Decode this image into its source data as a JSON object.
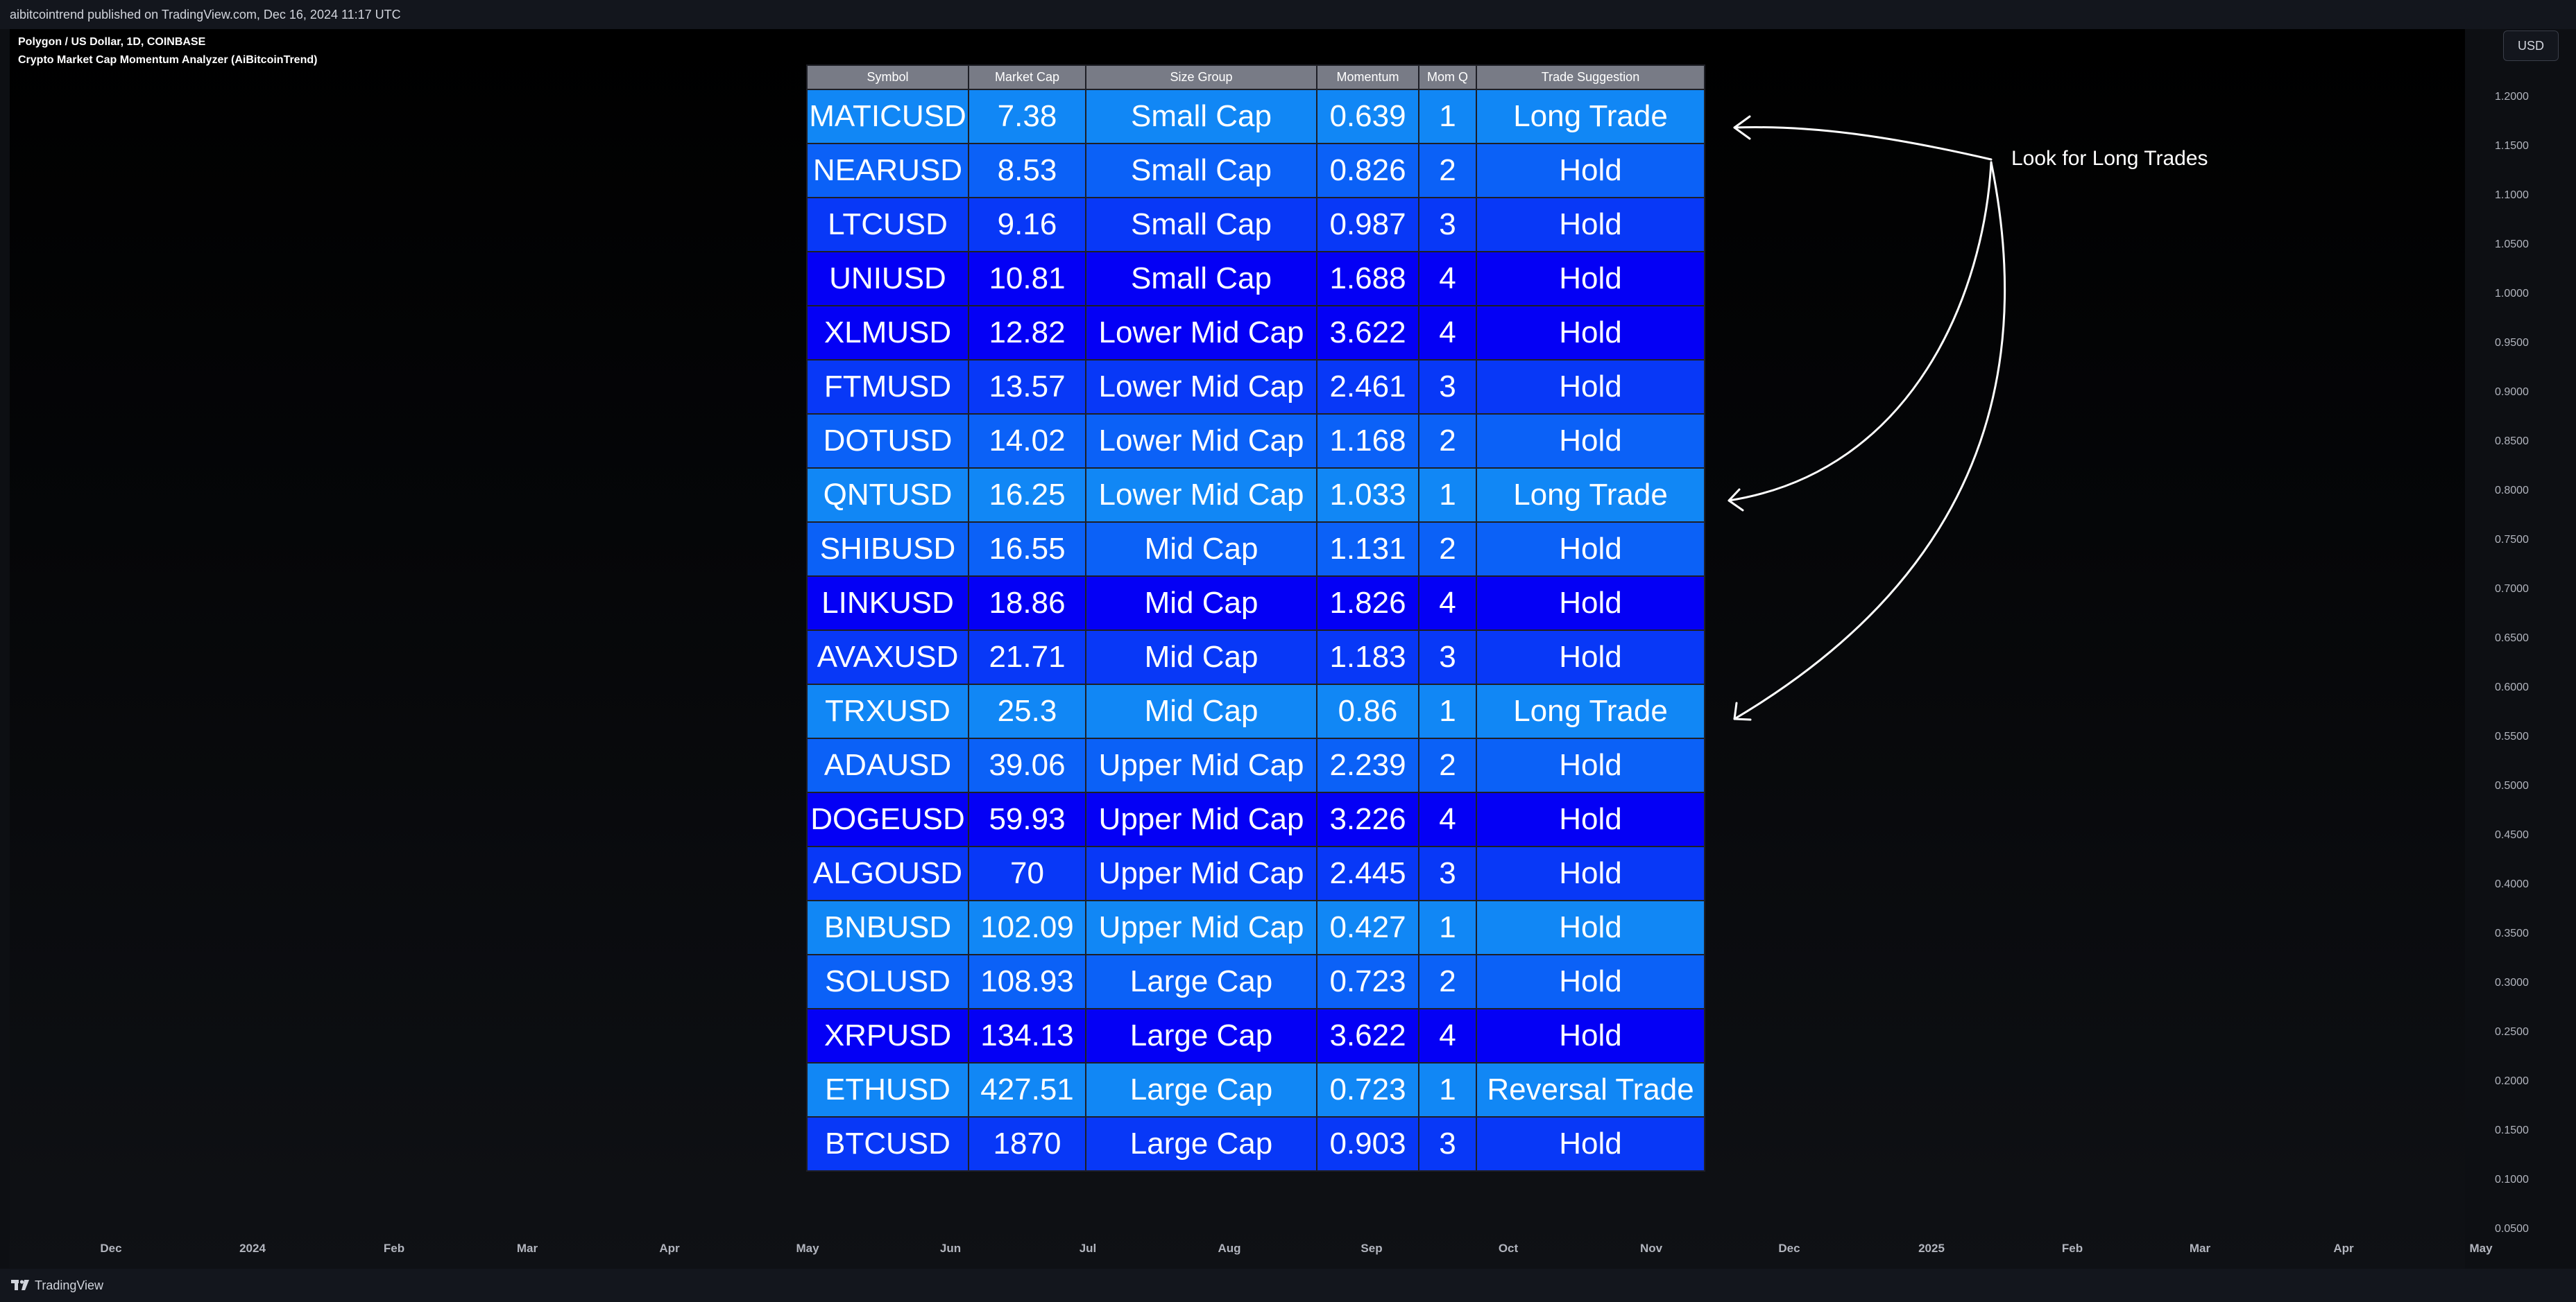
{
  "header": {
    "published": "aibitcointrend published on TradingView.com, Dec 16, 2024 11:17 UTC",
    "symbol_line": "Polygon / US Dollar, 1D, COINBASE",
    "indicator_line": "Crypto Market Cap Momentum Analyzer (AiBitcoinTrend)"
  },
  "currency_badge": "USD",
  "price_axis": [
    "1.2000",
    "1.1500",
    "1.1000",
    "1.0500",
    "1.0000",
    "0.9500",
    "0.9000",
    "0.8500",
    "0.8000",
    "0.7500",
    "0.7000",
    "0.6500",
    "0.6000",
    "0.5500",
    "0.5000",
    "0.4500",
    "0.4000",
    "0.3500",
    "0.3000",
    "0.2500",
    "0.2000",
    "0.1500",
    "0.1000",
    "0.0500"
  ],
  "time_axis": [
    "Dec",
    "2024",
    "Feb",
    "Mar",
    "Apr",
    "May",
    "Jun",
    "Jul",
    "Aug",
    "Sep",
    "Oct",
    "Nov",
    "Dec",
    "2025",
    "Feb",
    "Mar",
    "Apr",
    "May"
  ],
  "table": {
    "columns": [
      "Symbol",
      "Market Cap",
      "Size Group",
      "Momentum",
      "Mom Q",
      "Trade Suggestion"
    ],
    "quartile_colors": {
      "1": "#1187f5",
      "2": "#0b61f7",
      "3": "#0838f7",
      "4": "#0400f5"
    },
    "rows": [
      {
        "symbol": "MATICUSD",
        "market_cap": "7.38",
        "size_group": "Small Cap",
        "momentum": "0.639",
        "mom_q": "1",
        "suggestion": "Long Trade"
      },
      {
        "symbol": "NEARUSD",
        "market_cap": "8.53",
        "size_group": "Small Cap",
        "momentum": "0.826",
        "mom_q": "2",
        "suggestion": "Hold"
      },
      {
        "symbol": "LTCUSD",
        "market_cap": "9.16",
        "size_group": "Small Cap",
        "momentum": "0.987",
        "mom_q": "3",
        "suggestion": "Hold"
      },
      {
        "symbol": "UNIUSD",
        "market_cap": "10.81",
        "size_group": "Small Cap",
        "momentum": "1.688",
        "mom_q": "4",
        "suggestion": "Hold"
      },
      {
        "symbol": "XLMUSD",
        "market_cap": "12.82",
        "size_group": "Lower Mid Cap",
        "momentum": "3.622",
        "mom_q": "4",
        "suggestion": "Hold"
      },
      {
        "symbol": "FTMUSD",
        "market_cap": "13.57",
        "size_group": "Lower Mid Cap",
        "momentum": "2.461",
        "mom_q": "3",
        "suggestion": "Hold"
      },
      {
        "symbol": "DOTUSD",
        "market_cap": "14.02",
        "size_group": "Lower Mid Cap",
        "momentum": "1.168",
        "mom_q": "2",
        "suggestion": "Hold"
      },
      {
        "symbol": "QNTUSD",
        "market_cap": "16.25",
        "size_group": "Lower Mid Cap",
        "momentum": "1.033",
        "mom_q": "1",
        "suggestion": "Long Trade"
      },
      {
        "symbol": "SHIBUSD",
        "market_cap": "16.55",
        "size_group": "Mid Cap",
        "momentum": "1.131",
        "mom_q": "2",
        "suggestion": "Hold"
      },
      {
        "symbol": "LINKUSD",
        "market_cap": "18.86",
        "size_group": "Mid Cap",
        "momentum": "1.826",
        "mom_q": "4",
        "suggestion": "Hold"
      },
      {
        "symbol": "AVAXUSD",
        "market_cap": "21.71",
        "size_group": "Mid Cap",
        "momentum": "1.183",
        "mom_q": "3",
        "suggestion": "Hold"
      },
      {
        "symbol": "TRXUSD",
        "market_cap": "25.3",
        "size_group": "Mid Cap",
        "momentum": "0.86",
        "mom_q": "1",
        "suggestion": "Long Trade"
      },
      {
        "symbol": "ADAUSD",
        "market_cap": "39.06",
        "size_group": "Upper Mid Cap",
        "momentum": "2.239",
        "mom_q": "2",
        "suggestion": "Hold"
      },
      {
        "symbol": "DOGEUSD",
        "market_cap": "59.93",
        "size_group": "Upper Mid Cap",
        "momentum": "3.226",
        "mom_q": "4",
        "suggestion": "Hold"
      },
      {
        "symbol": "ALGOUSD",
        "market_cap": "70",
        "size_group": "Upper Mid Cap",
        "momentum": "2.445",
        "mom_q": "3",
        "suggestion": "Hold"
      },
      {
        "symbol": "BNBUSD",
        "market_cap": "102.09",
        "size_group": "Upper Mid Cap",
        "momentum": "0.427",
        "mom_q": "1",
        "suggestion": "Hold"
      },
      {
        "symbol": "SOLUSD",
        "market_cap": "108.93",
        "size_group": "Large Cap",
        "momentum": "0.723",
        "mom_q": "2",
        "suggestion": "Hold"
      },
      {
        "symbol": "XRPUSD",
        "market_cap": "134.13",
        "size_group": "Large Cap",
        "momentum": "3.622",
        "mom_q": "4",
        "suggestion": "Hold"
      },
      {
        "symbol": "ETHUSD",
        "market_cap": "427.51",
        "size_group": "Large Cap",
        "momentum": "0.723",
        "mom_q": "1",
        "suggestion": "Reversal Trade"
      },
      {
        "symbol": "BTCUSD",
        "market_cap": "1870",
        "size_group": "Large Cap",
        "momentum": "0.903",
        "mom_q": "3",
        "suggestion": "Hold"
      }
    ]
  },
  "annotation": {
    "text": "Look for Long Trades"
  },
  "footer": {
    "brand": "TradingView"
  }
}
